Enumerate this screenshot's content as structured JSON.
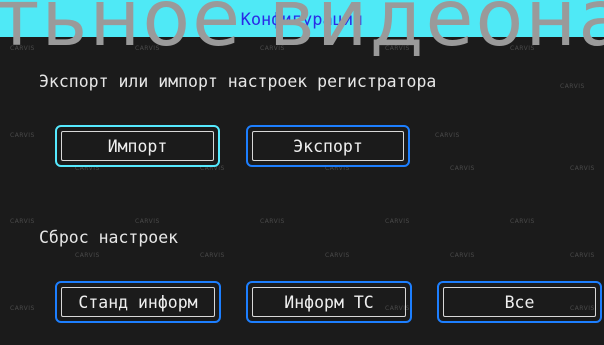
{
  "title": "Конфигурация",
  "watermark": "тьное видеонабл",
  "brand": "CARVIS",
  "export_import": {
    "label": "Экспорт или импорт настроек регистратора",
    "import_button": "Импорт",
    "export_button": "Экспорт"
  },
  "reset": {
    "label": "Сброс настроек",
    "standard_info_button": "Станд информ",
    "vehicle_info_button": "Информ ТС",
    "all_button": "Все"
  },
  "colors": {
    "title_bar": "#4fe9f6",
    "title_text": "#2a2ae6",
    "background": "#1b1b1b",
    "button_border": "#1d7fff",
    "focused_border": "#56eaff"
  }
}
